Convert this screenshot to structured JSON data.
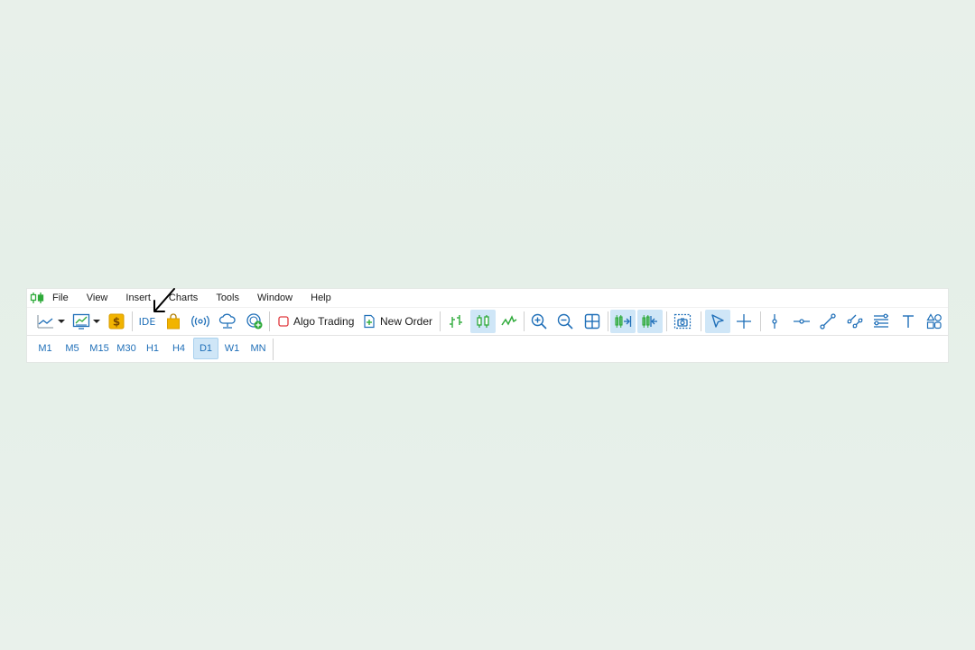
{
  "menu": {
    "items": [
      {
        "label": "File"
      },
      {
        "label": "View"
      },
      {
        "label": "Insert"
      },
      {
        "label": "Charts"
      },
      {
        "label": "Tools"
      },
      {
        "label": "Window"
      },
      {
        "label": "Help"
      }
    ]
  },
  "toolbar": {
    "ide_label": "IDE",
    "algo_trading_label": "Algo Trading",
    "new_order_label": "New Order",
    "icons": [
      "line-chart-icon",
      "dropdown-arrow-icon",
      "chart-template-icon",
      "dropdown-arrow-icon",
      "dollar-icon",
      "ide-icon",
      "shopping-bag-icon",
      "signals-icon",
      "cloud-icon",
      "vps-icon",
      "algo-trading-icon",
      "new-order-icon",
      "bar-chart-icon",
      "candlestick-icon",
      "line-graph-icon",
      "zoom-in-icon",
      "zoom-out-icon",
      "tile-windows-icon",
      "auto-scroll-icon",
      "chart-shift-icon",
      "screenshot-icon",
      "cursor-icon",
      "crosshair-icon",
      "vertical-line-icon",
      "horizontal-line-icon",
      "trend-line-icon",
      "parallel-channel-icon",
      "fibonacci-icon",
      "text-icon",
      "shapes-icon"
    ],
    "colors": {
      "blue": "#1f6fb8",
      "green": "#2eaa3a",
      "gold": "#f2b400",
      "red": "#e0393e",
      "active_bg": "#cfe6f7"
    }
  },
  "timeframes": {
    "items": [
      {
        "label": "M1"
      },
      {
        "label": "M5"
      },
      {
        "label": "M15"
      },
      {
        "label": "M30"
      },
      {
        "label": "H1"
      },
      {
        "label": "H4"
      },
      {
        "label": "D1"
      },
      {
        "label": "W1"
      },
      {
        "label": "MN"
      }
    ],
    "selected": "D1"
  }
}
